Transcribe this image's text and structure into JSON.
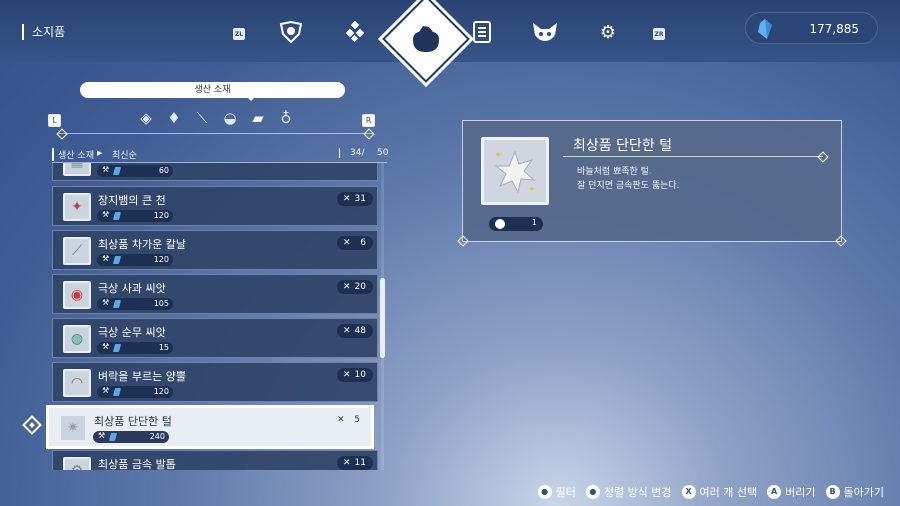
{
  "header": {
    "title": "소지품",
    "left_shoulder": "ZL",
    "right_shoulder": "ZR",
    "tabs": [
      {
        "icon": "emblem-icon"
      },
      {
        "icon": "diamonds-icon"
      },
      {
        "icon": "pouch-icon",
        "active": true
      },
      {
        "icon": "notebook-icon"
      },
      {
        "icon": "mask-icon"
      },
      {
        "icon": "gear-icon"
      }
    ],
    "currency_amount": "177,885",
    "currency_icon": "crystal-icon"
  },
  "category": {
    "label": "생산 소재",
    "left_button": "L",
    "right_button": "R",
    "icons": [
      "gem-rune-icon",
      "diamond-icon",
      "bone-icon",
      "mortar-icon",
      "fabric-icon",
      "potion-icon"
    ]
  },
  "sort": {
    "category": "생산 소재",
    "order": "최신순",
    "count": "34/",
    "total": "50"
  },
  "items": [
    {
      "name": "",
      "price": "60",
      "qty": "",
      "thumb": "▦",
      "thumb_color": "#6aa3a0"
    },
    {
      "name": "장지뱀의 큰 천",
      "price": "120",
      "qty": "31",
      "thumb": "✦",
      "thumb_color": "#c9404a"
    },
    {
      "name": "최상품 차가운 칼날",
      "price": "120",
      "qty": "6",
      "thumb": "⟋",
      "thumb_color": "#6b7890"
    },
    {
      "name": "극상 사과 씨앗",
      "price": "105",
      "qty": "20",
      "thumb": "◉",
      "thumb_color": "#d0343f"
    },
    {
      "name": "극상 순무 씨앗",
      "price": "15",
      "qty": "48",
      "thumb": "◍",
      "thumb_color": "#2e9a7a"
    },
    {
      "name": "벼락을 부르는 양뿔",
      "price": "120",
      "qty": "10",
      "thumb": "◠",
      "thumb_color": "#8a6a40"
    },
    {
      "name": "최상품 단단한 털",
      "price": "240",
      "qty": "5",
      "thumb": "✷",
      "thumb_color": "#9aa0aa",
      "selected": true
    },
    {
      "name": "최상품 금속 발톱",
      "price": "",
      "qty": "11",
      "thumb": "⚙",
      "thumb_color": "#7a8292"
    }
  ],
  "detail": {
    "title": "최상품 단단한 털",
    "description": [
      "바늘처럼 뾰족한 털.",
      "잘 던지면 금속판도 뚫는다."
    ],
    "owned": "1"
  },
  "hints": [
    {
      "button": "●",
      "label": "필터"
    },
    {
      "button": "●",
      "label": "정렬 방식 변경"
    },
    {
      "button": "X",
      "label": "여러 개 선택"
    },
    {
      "button": "A",
      "label": "버리기"
    },
    {
      "button": "B",
      "label": "돌아가기"
    }
  ]
}
